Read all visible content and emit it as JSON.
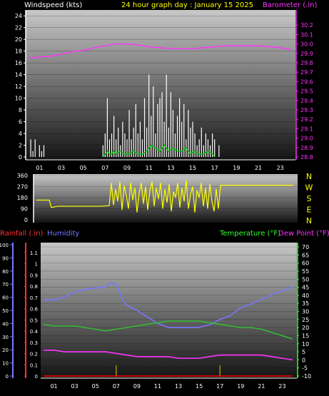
{
  "header": {
    "windspeed_label": "Windspeed (kts)",
    "title": "24 hour graph day : January 15 2025",
    "barometer_label": "Barometer (.in)"
  },
  "colors": {
    "background": "#000000",
    "gust": "#ffffff",
    "avg_wind": "#00cc00",
    "barometer": "#ff33ff",
    "direction": "#ffff00",
    "rain": "#ff0000",
    "humidity": "#7777ff",
    "temperature": "#33bb33",
    "dewpoint": "#ff33ff"
  },
  "bottom_legend": {
    "rain": "Rainfall (.in)",
    "humidity": "Humidity",
    "temperature": "Temperature (°F)",
    "dewpoint": "Dew Point (°F)"
  },
  "hour_labels": [
    "01",
    "03",
    "05",
    "07",
    "09",
    "11",
    "13",
    "15",
    "17",
    "19",
    "21",
    "23"
  ],
  "chart_data": [
    {
      "type": "bar",
      "title": "24 hour graph day : January 15 2025",
      "xlabel": "",
      "ylabel": "Windspeed (kts)",
      "ylim": [
        0,
        25
      ],
      "yticks": [
        0,
        2,
        4,
        6,
        8,
        10,
        12,
        14,
        16,
        18,
        20,
        22,
        24
      ],
      "x_range_hours": [
        0,
        24
      ],
      "series": [
        {
          "name": "Gust",
          "type": "bar",
          "x": [
            0.2,
            0.4,
            0.6,
            0.8,
            1.0,
            1.2,
            1.4,
            6.8,
            7.0,
            7.2,
            7.4,
            7.6,
            7.8,
            8.0,
            8.2,
            8.4,
            8.6,
            8.8,
            9.0,
            9.2,
            9.4,
            9.6,
            9.8,
            10.0,
            10.2,
            10.4,
            10.6,
            10.8,
            11.0,
            11.2,
            11.4,
            11.6,
            11.8,
            12.0,
            12.2,
            12.4,
            12.6,
            12.8,
            13.0,
            13.2,
            13.4,
            13.6,
            13.8,
            14.0,
            14.2,
            14.4,
            14.6,
            14.8,
            15.0,
            15.2,
            15.4,
            15.6,
            15.8,
            16.0,
            16.2,
            16.4,
            16.6,
            16.8,
            17.0,
            17.4
          ],
          "values": [
            3,
            1,
            3,
            0,
            2,
            1,
            2,
            2,
            4,
            10,
            3,
            4,
            7,
            3,
            5,
            2,
            6,
            4,
            3,
            8,
            3,
            5,
            9,
            4,
            6,
            3,
            10,
            5,
            14,
            7,
            12,
            4,
            9,
            10,
            11,
            6,
            14,
            5,
            11,
            8,
            4,
            7,
            10,
            6,
            9,
            3,
            8,
            5,
            6,
            4,
            2,
            3,
            5,
            2,
            4,
            3,
            2,
            4,
            3,
            2
          ]
        },
        {
          "name": "Average",
          "type": "line",
          "x": [
            6.8,
            7.0,
            7.2,
            7.4,
            7.6,
            7.8,
            8.0,
            8.4,
            8.8,
            9.2,
            9.6,
            10.0,
            10.4,
            10.8,
            11.2,
            11.6,
            12.0,
            12.4,
            12.8,
            13.2,
            13.6,
            14.0,
            14.4,
            14.8,
            15.2,
            15.6,
            16.0,
            16.4,
            16.8,
            17.0
          ],
          "values": [
            0,
            0.5,
            1,
            0.5,
            0.5,
            1,
            0.5,
            1,
            0.5,
            0.5,
            1,
            0.5,
            0.5,
            1,
            2,
            1.5,
            1,
            2,
            1,
            1.5,
            1,
            1,
            1.5,
            0.5,
            1,
            0.5,
            0.5,
            1,
            0.5,
            0
          ]
        }
      ]
    },
    {
      "type": "line",
      "title": "",
      "xlabel": "",
      "ylabel": "Barometer (.in)",
      "ylim": [
        28.8,
        30.3
      ],
      "yticks": [
        28.8,
        28.9,
        29.0,
        29.1,
        29.2,
        29.3,
        29.4,
        29.5,
        29.6,
        29.7,
        29.8,
        29.9,
        30.0,
        30.1,
        30.2
      ],
      "series": [
        {
          "name": "Barometer",
          "x": [
            0,
            1,
            2,
            3,
            4,
            5,
            6,
            7,
            8,
            9,
            10,
            11,
            12,
            13,
            14,
            15,
            16,
            17,
            18,
            19,
            20,
            21,
            22,
            23,
            24
          ],
          "values": [
            29.85,
            29.86,
            29.87,
            29.89,
            29.92,
            29.93,
            29.96,
            29.98,
            30.0,
            30.0,
            29.99,
            29.97,
            29.96,
            29.95,
            29.95,
            29.95,
            29.96,
            29.97,
            29.98,
            29.98,
            29.98,
            29.98,
            29.97,
            29.96,
            29.94
          ]
        }
      ]
    },
    {
      "type": "line",
      "title": "",
      "xlabel": "",
      "ylabel": "",
      "ylim": [
        0,
        360
      ],
      "yticks": [
        0,
        90,
        180,
        270,
        360
      ],
      "direction_labels": [
        "N",
        "W",
        "S",
        "E",
        "N"
      ],
      "series": [
        {
          "name": "Wind Direction",
          "x": [
            0,
            1.2,
            1.4,
            2.0,
            3.0,
            4.0,
            5.0,
            6.0,
            6.8,
            7.0,
            7.2,
            7.4,
            7.6,
            7.8,
            8.0,
            8.2,
            8.4,
            8.6,
            8.8,
            9.0,
            9.2,
            9.4,
            9.6,
            9.8,
            10.0,
            10.2,
            10.4,
            10.6,
            10.8,
            11.0,
            11.2,
            11.4,
            11.6,
            11.8,
            12.0,
            12.2,
            12.4,
            12.6,
            12.8,
            13.0,
            13.2,
            13.4,
            13.6,
            13.8,
            14.0,
            14.2,
            14.4,
            14.6,
            14.8,
            15.0,
            15.2,
            15.4,
            15.6,
            15.8,
            16.0,
            16.2,
            16.4,
            16.6,
            16.8,
            17.0,
            17.2,
            17.4,
            18,
            20,
            22,
            24
          ],
          "values": [
            160,
            160,
            100,
            110,
            110,
            110,
            110,
            110,
            115,
            300,
            120,
            250,
            150,
            310,
            80,
            280,
            200,
            90,
            300,
            160,
            260,
            60,
            220,
            300,
            130,
            270,
            80,
            240,
            310,
            110,
            260,
            170,
            300,
            90,
            250,
            140,
            290,
            70,
            230,
            180,
            300,
            100,
            260,
            150,
            320,
            90,
            210,
            270,
            60,
            240,
            180,
            300,
            110,
            260,
            90,
            290,
            150,
            70,
            250,
            90,
            280,
            280,
            280,
            280,
            280,
            280
          ]
        }
      ]
    },
    {
      "type": "line",
      "title": "",
      "xlabel": "",
      "ylabel": "Humidity",
      "ylim": [
        0,
        100
      ],
      "yticks": [
        0,
        10,
        20,
        30,
        40,
        50,
        60,
        70,
        80,
        90,
        100
      ],
      "right_ylabel": "Temperature (°F)",
      "right_ylim": [
        -10,
        70
      ],
      "right_yticks": [
        -10,
        -5,
        0,
        5,
        10,
        15,
        20,
        25,
        30,
        35,
        40,
        45,
        50,
        55,
        60,
        65,
        70
      ],
      "rain_ylabel": "Rainfall (.in)",
      "rain_ylim": [
        0,
        1.1
      ],
      "rain_yticks": [
        0,
        0.1,
        0.2,
        0.3,
        0.4,
        0.5,
        0.6,
        0.7,
        0.8,
        0.9,
        1,
        1.1
      ],
      "series": [
        {
          "name": "Humidity",
          "axis": "left",
          "x": [
            0,
            1,
            2,
            3,
            4,
            5,
            6,
            6.5,
            7,
            7.3,
            7.6,
            8,
            9,
            10,
            11,
            12,
            13,
            14,
            15,
            16,
            17,
            18,
            19,
            20,
            21,
            22,
            23,
            24
          ],
          "values": [
            58,
            58,
            60,
            64,
            66,
            67,
            68,
            71,
            70,
            64,
            58,
            54,
            50,
            45,
            40,
            37,
            37,
            37,
            37,
            39,
            43,
            46,
            52,
            55,
            58,
            62,
            65,
            68
          ]
        },
        {
          "name": "Temperature",
          "axis": "right",
          "x": [
            0,
            1,
            2,
            3,
            4,
            5,
            6,
            7,
            8,
            9,
            10,
            11,
            12,
            13,
            14,
            15,
            16,
            17,
            18,
            19,
            20,
            21,
            22,
            23,
            24
          ],
          "values": [
            22,
            21,
            21,
            21,
            20,
            19,
            18,
            19,
            20,
            21,
            22,
            23,
            24,
            24,
            24,
            24,
            23,
            22,
            21,
            20,
            20,
            19,
            17,
            15,
            13
          ]
        },
        {
          "name": "Dew Point",
          "axis": "right",
          "x": [
            0,
            1,
            2,
            3,
            4,
            5,
            6,
            7,
            8,
            9,
            10,
            11,
            12,
            13,
            14,
            15,
            16,
            17,
            18,
            19,
            20,
            21,
            22,
            23,
            24
          ],
          "values": [
            6,
            6,
            5,
            5,
            5,
            5,
            5,
            4,
            3,
            2,
            2,
            2,
            2,
            1,
            1,
            1,
            2,
            3,
            3,
            3,
            3,
            3,
            2,
            1,
            0
          ]
        },
        {
          "name": "Rainfall",
          "axis": "rain",
          "x": [
            0,
            24
          ],
          "values": [
            0,
            0
          ]
        }
      ]
    }
  ]
}
